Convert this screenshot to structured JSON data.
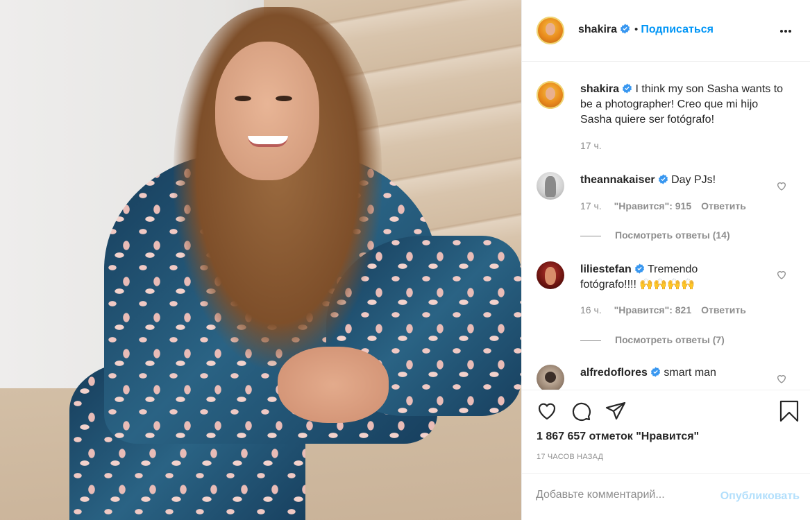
{
  "post": {
    "author": "shakira",
    "follow_label": "Подписаться",
    "separator": "•",
    "caption": "I think my son Sasha wants to be a photographer! Creo que mi hijo Sasha quiere ser fotógrafo!",
    "caption_time": "17 ч."
  },
  "comments": [
    {
      "user": "theannakaiser",
      "text": "Day PJs!",
      "time": "17 ч.",
      "likes": "\"Нравится\": 915",
      "reply_label": "Ответить",
      "view_replies": "Посмотреть ответы (14)"
    },
    {
      "user": "liliestefan",
      "text": "Tremendo fotógrafo!!!! 🙌🙌🙌🙌",
      "time": "16 ч.",
      "likes": "\"Нравится\": 821",
      "reply_label": "Ответить",
      "view_replies": "Посмотреть ответы (7)"
    },
    {
      "user": "alfredoflores",
      "text": "smart man"
    }
  ],
  "footer": {
    "likes_count": "1 867 657 отметок \"Нравится\"",
    "time_ago": "17 ЧАСОВ НАЗАД",
    "comment_placeholder": "Добавьте комментарий...",
    "publish_label": "Опубликовать"
  },
  "colors": {
    "accent": "#0095f6",
    "publish_disabled": "#b2dffc",
    "muted": "#8e8e8e"
  },
  "icons": [
    "heart-icon",
    "comment-icon",
    "share-icon",
    "bookmark-icon",
    "verified-icon",
    "more-icon"
  ]
}
